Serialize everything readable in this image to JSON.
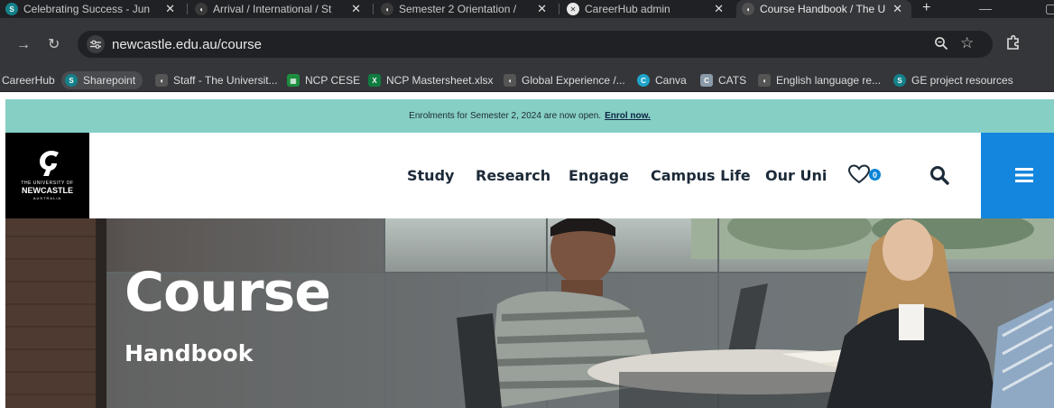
{
  "browser": {
    "tabs": [
      {
        "title": "Celebrating Success - Jun",
        "favicon": "sharepoint-icon",
        "active": false
      },
      {
        "title": "Arrival / International / St",
        "favicon": "newcastle-icon",
        "active": false
      },
      {
        "title": "Semester 2 Orientation /",
        "favicon": "newcastle-icon",
        "active": false
      },
      {
        "title": "CareerHub admin",
        "favicon": "careerhub-icon",
        "active": false
      },
      {
        "title": "Course Handbook / The U",
        "favicon": "newcastle-icon",
        "active": true
      }
    ],
    "new_tab_label": "+",
    "url": "newcastle.edu.au/course",
    "bookmarks": [
      {
        "label": "CareerHub",
        "icon": "none"
      },
      {
        "label": "Sharepoint",
        "icon": "sharepoint-icon"
      },
      {
        "label": "Staff - The Universit...",
        "icon": "newcastle-icon"
      },
      {
        "label": "NCP CESE",
        "icon": "sheets-icon"
      },
      {
        "label": "NCP Mastersheet.xlsx",
        "icon": "excel-icon"
      },
      {
        "label": "Global Experience /...",
        "icon": "newcastle-icon"
      },
      {
        "label": "Canva",
        "icon": "canva-icon"
      },
      {
        "label": "CATS",
        "icon": "cats-icon"
      },
      {
        "label": "English language re...",
        "icon": "newcastle-icon"
      },
      {
        "label": "GE project resources",
        "icon": "sharepoint-icon"
      }
    ]
  },
  "site": {
    "banner": {
      "text": "Enrolments for Semester 2, 2024 are now open.",
      "link": "Enrol now."
    },
    "logo": {
      "line1": "THE UNIVERSITY OF",
      "line2": "NEWCASTLE",
      "line3": "AUSTRALIA"
    },
    "nav": [
      "Study",
      "Research",
      "Engage",
      "Campus Life",
      "Our Uni"
    ],
    "favourites_count": "0",
    "hero": {
      "title": "Course",
      "subtitle": "Handbook"
    }
  },
  "colors": {
    "banner_bg": "#86cfc5",
    "menu_bg": "#1486dd",
    "badge": "#0a84d6",
    "nav_text": "#1c2a38"
  }
}
